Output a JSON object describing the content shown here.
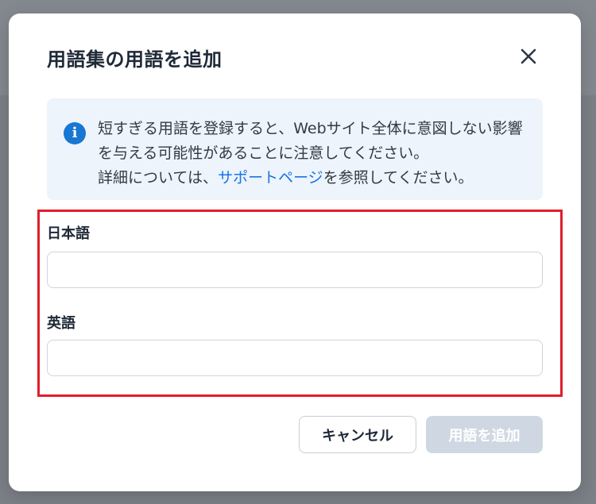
{
  "dialog": {
    "title": "用語集の用語を追加",
    "close_icon": "close-icon"
  },
  "notice": {
    "icon": "info-icon",
    "icon_glyph": "i",
    "text_before_link": "短すぎる用語を登録すると、Webサイト全体に意図しない影響を与える可能性があることに注意してください。\n詳細については、",
    "link_text": "サポートページ",
    "text_after_link": "を参照してください。"
  },
  "fields": {
    "japanese": {
      "label": "日本語",
      "value": "",
      "placeholder": ""
    },
    "english": {
      "label": "英語",
      "value": "",
      "placeholder": ""
    }
  },
  "actions": {
    "cancel_label": "キャンセル",
    "add_label": "用語を追加",
    "add_enabled": false
  },
  "colors": {
    "accent": "#1a73e8",
    "info_bg": "#edf4fc",
    "highlight": "#e01e2b",
    "disabled_button": "#cfd8e2"
  }
}
